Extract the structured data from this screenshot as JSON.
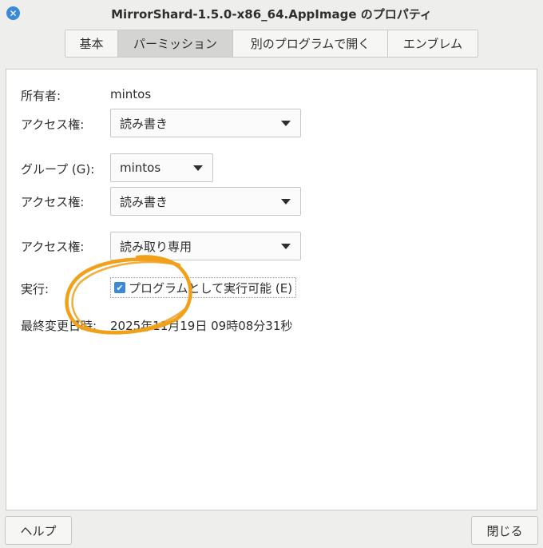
{
  "window": {
    "title": "MirrorShard-1.5.0-x86_64.AppImage のプロパティ",
    "close_icon": "close-icon"
  },
  "tabs": [
    {
      "label": "基本",
      "active": false
    },
    {
      "label": "パーミッション",
      "active": true
    },
    {
      "label": "別のプログラムで開く",
      "active": false
    },
    {
      "label": "エンブレム",
      "active": false
    }
  ],
  "permissions": {
    "owner_label": "所有者:",
    "owner_value": "mintos",
    "owner_access_label": "アクセス権:",
    "owner_access_value": "読み書き",
    "group_label": "グループ (G):",
    "group_value": "mintos",
    "group_access_label": "アクセス権:",
    "group_access_value": "読み書き",
    "other_access_label": "アクセス権:",
    "other_access_value": "読み取り専用",
    "execute_label": "実行:",
    "execute_checkbox_label": "プログラムとして実行可能 (E)",
    "execute_checked": true,
    "modified_label": "最終変更日時:",
    "modified_value": "2025年11月19日 09時08分31秒"
  },
  "buttons": {
    "help": "ヘルプ",
    "close": "閉じる"
  },
  "colors": {
    "accent": "#3a8ad8",
    "annotation": "#f0a01a",
    "window_bg": "#eeeeec",
    "panel_bg": "#ffffff",
    "active_tab": "#d4d4d2"
  }
}
